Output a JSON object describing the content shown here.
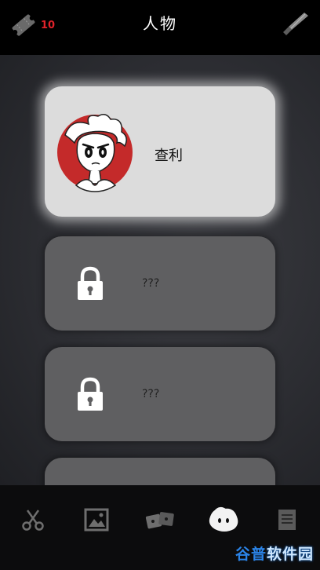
{
  "header": {
    "title": "人物",
    "ticket_count": "10"
  },
  "characters": [
    {
      "name": "查利",
      "locked": false
    },
    {
      "name": "???",
      "locked": true
    },
    {
      "name": "???",
      "locked": true
    },
    {
      "name": "",
      "locked": true
    }
  ],
  "tabs": [
    {
      "icon": "scissors-icon",
      "active": false
    },
    {
      "icon": "photo-gallery-icon",
      "active": false
    },
    {
      "icon": "cards-icon",
      "active": false
    },
    {
      "icon": "character-icon",
      "active": true
    },
    {
      "icon": "document-icon",
      "active": false
    }
  ],
  "watermark": {
    "part1": "谷普",
    "part2": "软件园"
  },
  "colors": {
    "background": "#000000",
    "ticket_count": "#e0222a",
    "card_unlocked": "#dcdcdc",
    "card_locked": "#5f5f61",
    "avatar_red": "#c42a2a"
  }
}
